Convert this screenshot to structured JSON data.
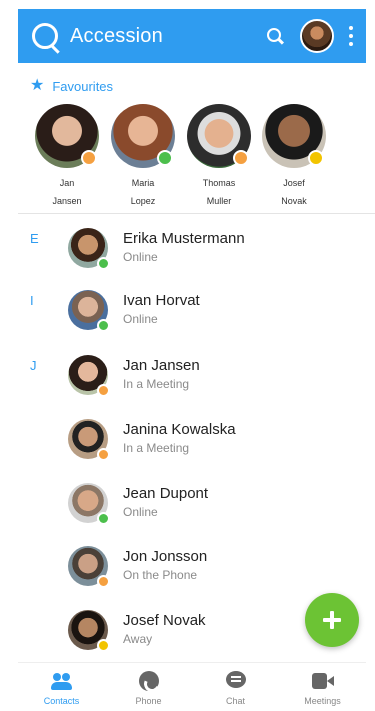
{
  "app": {
    "title": "Accession"
  },
  "favourites": {
    "heading": "Favourites",
    "items": [
      {
        "first": "Jan",
        "last": "Jansen",
        "status": "meeting"
      },
      {
        "first": "Maria",
        "last": "Lopez",
        "status": "online"
      },
      {
        "first": "Thomas",
        "last": "Muller",
        "status": "meeting"
      },
      {
        "first": "Josef",
        "last": "Novak",
        "status": "away"
      }
    ]
  },
  "contacts": [
    {
      "letter": "E",
      "name": "Erika Mustermann",
      "status": "Online",
      "badge": "online"
    },
    {
      "letter": "I",
      "name": "Ivan Horvat",
      "status": "Online",
      "badge": "online"
    },
    {
      "letter": "J",
      "name": "Jan Jansen",
      "status": "In a Meeting",
      "badge": "meeting"
    },
    {
      "letter": "",
      "name": "Janina Kowalska",
      "status": "In a Meeting",
      "badge": "meeting"
    },
    {
      "letter": "",
      "name": "Jean Dupont",
      "status": "Online",
      "badge": "online"
    },
    {
      "letter": "",
      "name": "Jon Jonsson",
      "status": "On the Phone",
      "badge": "meeting"
    },
    {
      "letter": "",
      "name": "Josef Novak",
      "status": "Away",
      "badge": "away"
    }
  ],
  "nav": {
    "contacts": "Contacts",
    "phone": "Phone",
    "chat": "Chat",
    "meetings": "Meetings"
  },
  "colors": {
    "brand": "#2f9cf0",
    "online": "#4cbf4c",
    "meeting": "#f5a040",
    "away": "#f2c400",
    "fab": "#6cc334"
  }
}
